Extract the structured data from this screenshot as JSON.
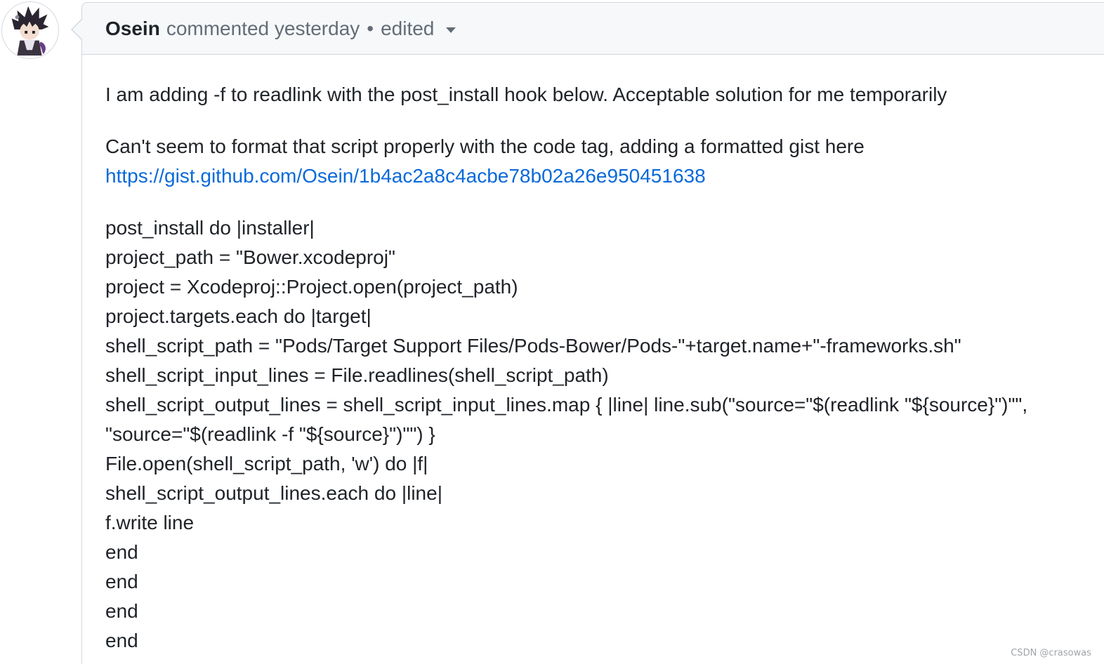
{
  "comment": {
    "author": "Osein",
    "action": "commented yesterday",
    "separator": "•",
    "edited_label": "edited",
    "paragraph_1": "I am adding -f to readlink with the post_install hook below. Acceptable solution for me temporarily",
    "paragraph_2": "Can't seem to format that script properly with the code tag, adding a formatted gist here",
    "gist_link": "https://gist.github.com/Osein/1b4ac2a8c4acbe78b02a26e950451638",
    "code_lines": [
      "post_install do |installer|",
      "project_path = \"Bower.xcodeproj\"",
      "project = Xcodeproj::Project.open(project_path)",
      "project.targets.each do |target|",
      "shell_script_path = \"Pods/Target Support Files/Pods-Bower/Pods-\"+target.name+\"-frameworks.sh\"",
      "shell_script_input_lines = File.readlines(shell_script_path)",
      "shell_script_output_lines = shell_script_input_lines.map { |line| line.sub(\"source=\"$(readlink \"${source}\")\"\",",
      "\"source=\"$(readlink -f \"${source}\")\"\") }",
      "File.open(shell_script_path, 'w') do |f|",
      "shell_script_output_lines.each do |line|",
      "f.write line",
      "end",
      "end",
      "end",
      "end"
    ]
  },
  "watermark": "CSDN @crasowas",
  "icons": {
    "avatar": "user-avatar-icon",
    "edited_dropdown": "chevron-down-icon"
  },
  "colors": {
    "link": "#0969da",
    "header_bg": "#f6f8fa",
    "border": "#d0d7de",
    "muted_text": "#636c76",
    "text": "#1f2328"
  }
}
